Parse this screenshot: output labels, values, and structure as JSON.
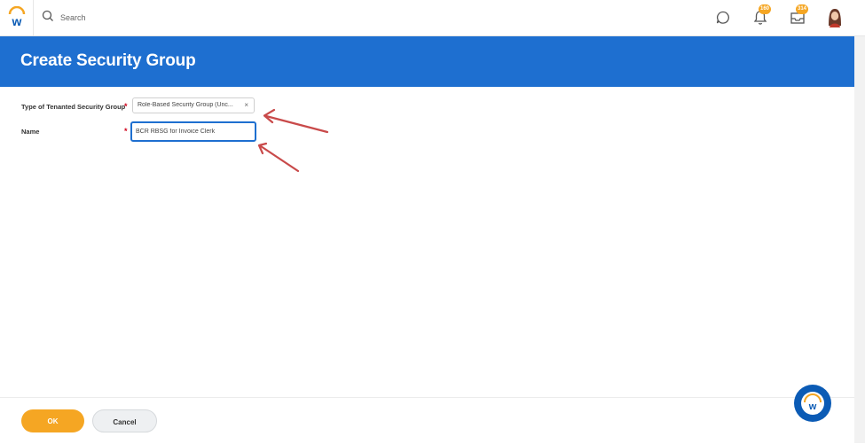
{
  "header": {
    "search": {
      "placeholder": "Search",
      "value": ""
    },
    "notifications": {
      "badge": "160"
    },
    "inbox": {
      "badge": "314"
    }
  },
  "page": {
    "title": "Create Security Group"
  },
  "form": {
    "type_field": {
      "label": "Type of Tenanted Security Group",
      "required_mark": "*",
      "value": "Role-Based Security Group (Unc...",
      "clear": "×"
    },
    "name_field": {
      "label": "Name",
      "required_mark": "*",
      "value": "BCR RBSG for Invoice Clerk"
    }
  },
  "footer": {
    "ok_label": "OK",
    "cancel_label": "Cancel"
  },
  "colors": {
    "brand_blue": "#1e6fd0",
    "accent_orange": "#f5a623",
    "required_red": "#d0021b",
    "annotation_red": "#c94a4a"
  },
  "icons": [
    "workday-logo-icon",
    "search-icon",
    "chat-icon",
    "bell-icon",
    "inbox-icon",
    "avatar",
    "assistant-icon",
    "annotation-arrow"
  ]
}
